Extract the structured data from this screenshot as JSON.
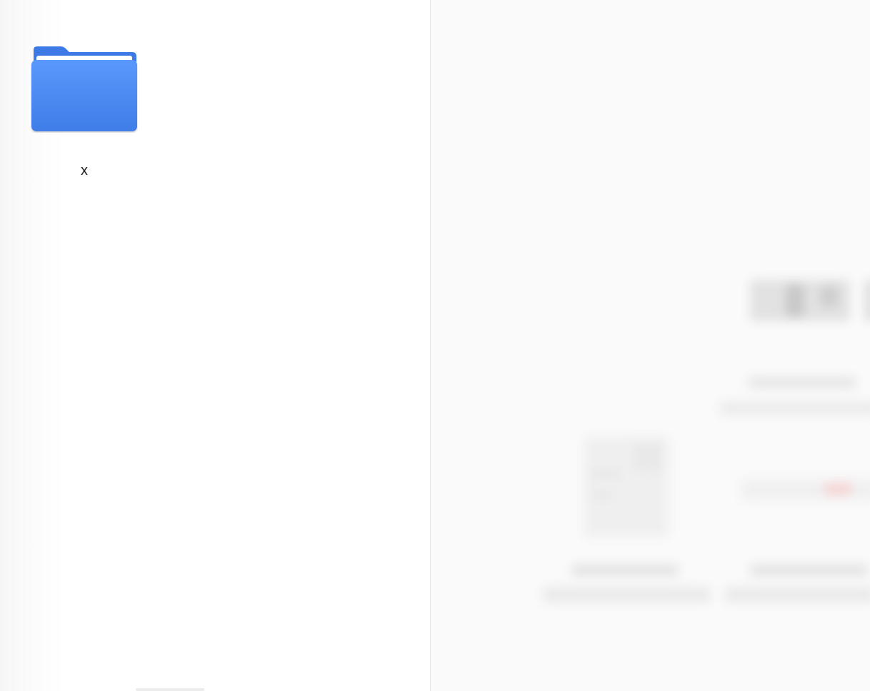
{
  "colors": {
    "folder_front": "#4f8ff7",
    "folder_back": "#3b78e7",
    "label_text": "#222222"
  },
  "file_browser": {
    "items": [
      {
        "type": "folder",
        "icon": "folder-icon",
        "name": "x"
      }
    ]
  }
}
